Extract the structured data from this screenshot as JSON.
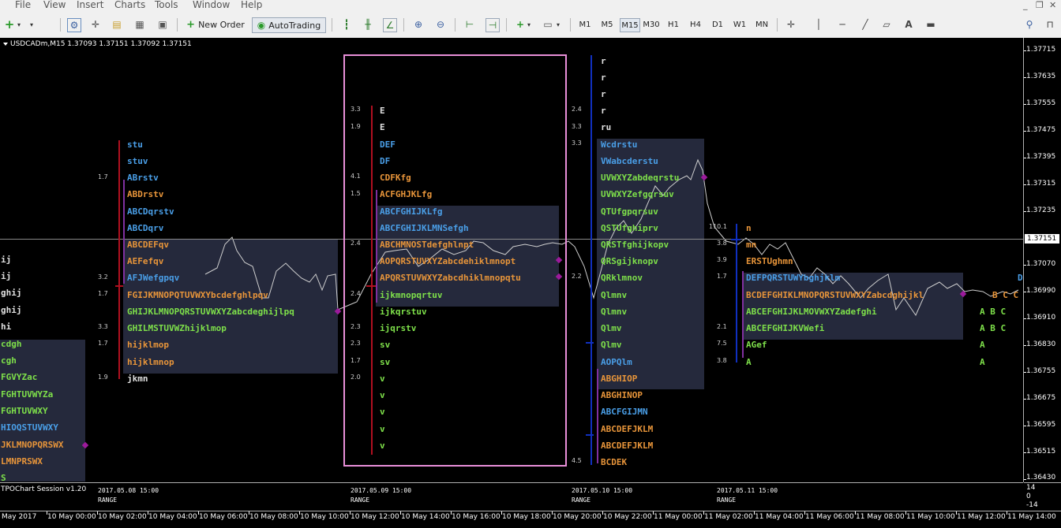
{
  "menu": [
    "File",
    "View",
    "Insert",
    "Charts",
    "Tools",
    "Window",
    "Help"
  ],
  "toolbar": {
    "new_order": "New Order",
    "autotrading": "AutoTrading",
    "timeframes": [
      "M1",
      "M5",
      "M15",
      "M30",
      "H1",
      "H4",
      "D1",
      "W1",
      "MN"
    ],
    "active_timeframe": "M15",
    "text_tool": "A"
  },
  "chart": {
    "title": "USDCADm,M15  1.37093 1.37151 1.37092 1.37151",
    "current_price": "1.37151",
    "price_labels": [
      "1.37715",
      "1.37635",
      "1.37555",
      "1.37475",
      "1.37395",
      "1.37315",
      "1.37235",
      "1.37070",
      "1.36990",
      "1.36910",
      "1.36830",
      "1.36755",
      "1.36675",
      "1.36595",
      "1.36515",
      "1.36430"
    ],
    "indicator_label": "TPOChart Session v1.20",
    "indicator_axis": [
      "14",
      "0",
      "-14"
    ],
    "time_labels": [
      "May 2017",
      "10 May 00:00",
      "10 May 02:00",
      "10 May 04:00",
      "10 May 06:00",
      "10 May 08:00",
      "10 May 10:00",
      "10 May 12:00",
      "10 May 14:00",
      "10 May 16:00",
      "10 May 18:00",
      "10 May 20:00",
      "10 May 22:00",
      "11 May 00:00",
      "11 May 02:00",
      "11 May 04:00",
      "11 May 06:00",
      "11 May 08:00",
      "11 May 10:00",
      "11 May 12:00",
      "11 May 14:00"
    ],
    "sessions": [
      {
        "date": "2017.05.08 15:00",
        "range": "RANGE"
      },
      {
        "date": "2017.05.09 15:00",
        "range": "RANGE"
      },
      {
        "date": "2017.05.10 15:00",
        "range": "RANGE"
      },
      {
        "date": "2017.05.11 15:00",
        "range": "RANGE"
      }
    ]
  },
  "colors": {
    "letter_blue": "#4a9fe8",
    "letter_orange": "#e8953a",
    "letter_green": "#7ee04a",
    "letter_white": "#ffffff",
    "bar_red": "#b01020",
    "bar_blue": "#1030c0",
    "bar_purple": "#8030a0",
    "pink_box": "#e88fd8",
    "value_area": "#2c3046"
  },
  "profiles": {
    "p0": {
      "rows": [
        [
          "ij"
        ],
        [
          "ij"
        ],
        [
          "ghij"
        ],
        [
          "ghij"
        ],
        [
          "hi"
        ],
        [
          "cdgh"
        ],
        [
          "cgh"
        ],
        [
          "FGVYZac"
        ],
        [
          "FGHTUVWYZa"
        ],
        [
          "FGHTUVWXY"
        ],
        [
          "HIOQSTUVWXY"
        ],
        [
          "JKLMNOPQRSWX"
        ],
        [
          "LMNPRSWX"
        ],
        [
          "S"
        ]
      ]
    },
    "p1": {
      "rows": [
        "stu",
        "stuv",
        "ABrstv",
        "ABDrstv",
        "ABCDqrstv",
        "ABCDqrv",
        "ABCDEFqv",
        "AEFefqv",
        "AFJWefgpqv",
        "FGIJKMNOPQTUVWXYbcdefghlpqv",
        "GHIJKLMNOPQRSTUVWXYZabcdeghijlpq",
        "GHILMSTUVWZhijklmop",
        "hijklmop",
        "hijklmnop",
        "jkmn"
      ],
      "nums": [
        "1.7",
        "3.2",
        "1.7",
        "3.3",
        "1.7",
        "1.9"
      ]
    },
    "p2": {
      "rows": [
        "E",
        "E",
        "DEF",
        "DF",
        "CDFKfg",
        "ACFGHJKLfg",
        "ABCFGHIJKLfg",
        "ABCFGHIJKLMNSefgh",
        "ABCHMNOSTdefghlnpt",
        "AOPQRSTUVXYZabcdehiklmnopt",
        "APQRSTUVWXYZabcdhiklmnopqtu",
        "ijkmnopqrtuv",
        "ijkqrstuv",
        "ijqrstv",
        "sv",
        "sv",
        "v",
        "v",
        "v",
        "v",
        "v"
      ],
      "nums": [
        "3.3",
        "1.9",
        "4.1",
        "1.5",
        "2.4",
        "2.4",
        "2.3",
        "2.3",
        "1.7",
        "2.0"
      ]
    },
    "p3": {
      "rows": [
        "r",
        "r",
        "r",
        "r",
        "ru",
        "Wcdrstu",
        "VWabcderstu",
        "UVWXYZabdeqrstu",
        "UVWXYZefgqrsuv",
        "QTUfgpqrsuv",
        "QSTUfghiprv",
        "QRSTfghijkopv",
        "QRSgijknopv",
        "QRklmnov",
        "Qlmnv",
        "Qlmnv",
        "Qlmv",
        "Qlmv",
        "AOPQlm",
        "ABGHIOP",
        "ABGHINOP",
        "ABCFGIJMN",
        "ABCDEFJKLM",
        "ABCDEFJKLM",
        "BCDEK"
      ],
      "nums": [
        "2.4",
        "3.3",
        "3.3",
        "2.2",
        "4.5"
      ]
    },
    "p4": {
      "rows": [
        "n",
        "mn",
        "ERSTUghmn",
        "DEFPQRSTUWYbghjklm",
        "BCDEFGHIKLMNOPQRSTUVWXYZabcdghijkl",
        "ABCEFGHIJKLMOVWXYZadefghi",
        "ABCEFGHIJKVWefi",
        "AGef",
        "A"
      ],
      "nums": [
        "110.1",
        "3.8",
        "3.9",
        "1.7",
        "2.1",
        "7.5",
        "3.8"
      ]
    },
    "p5": {
      "rows": [
        "B C C",
        "A B C",
        "A B C",
        "A",
        "A"
      ],
      "extra": "D"
    }
  }
}
